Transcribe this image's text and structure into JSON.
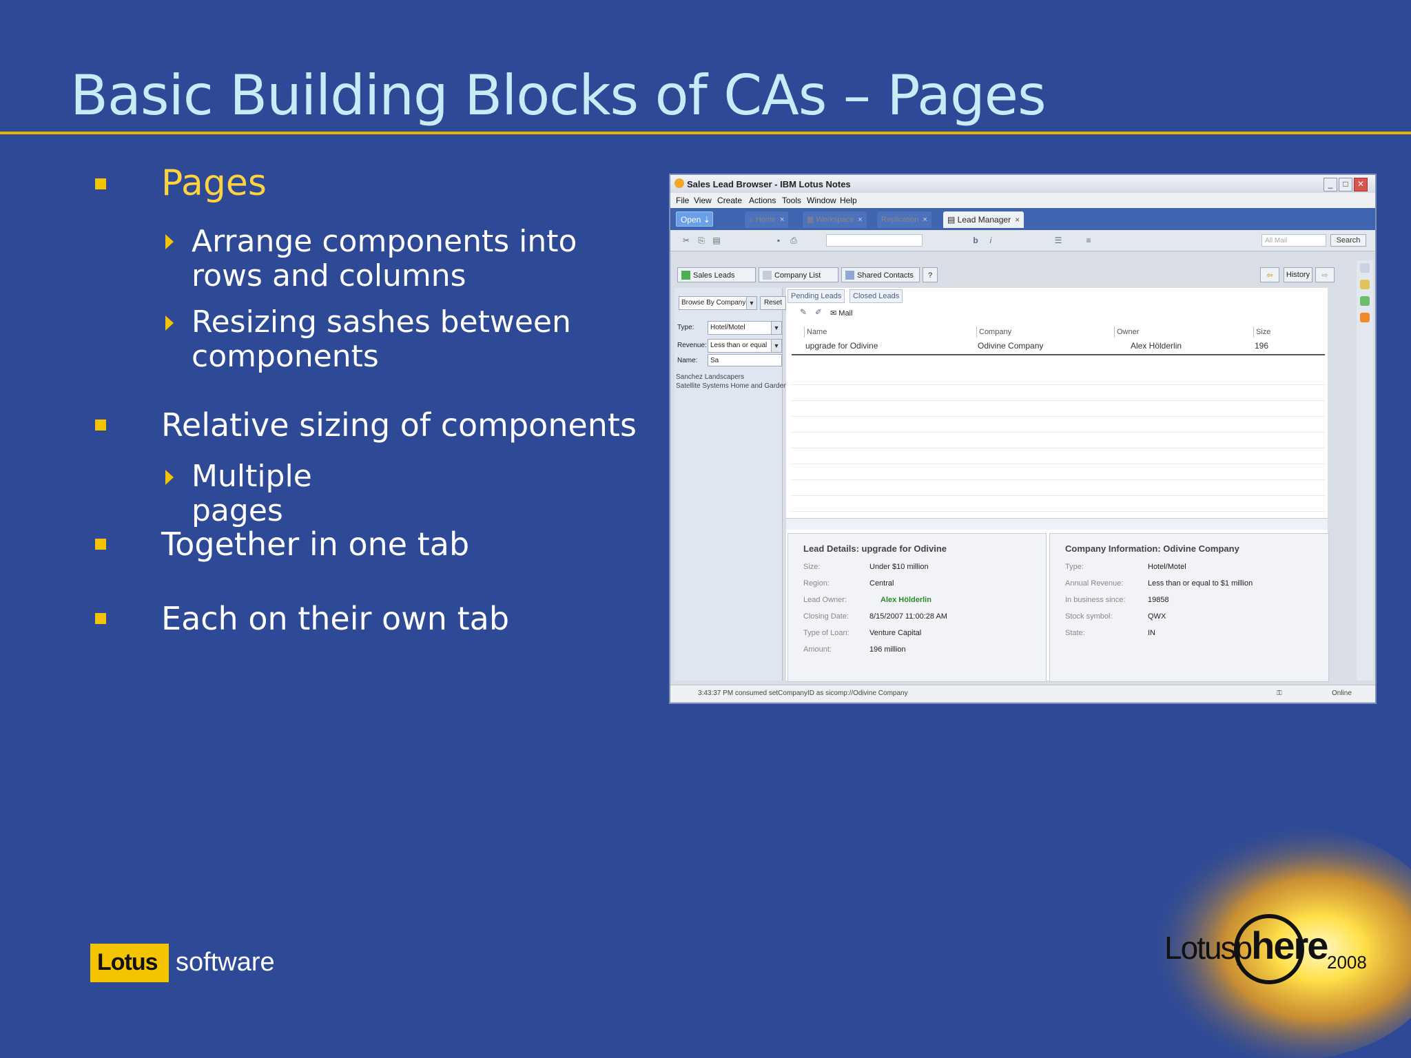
{
  "slide": {
    "title": "Basic Building Blocks of CAs – Pages",
    "bullets": [
      {
        "text": "Pages",
        "subs": [
          "Arrange components into rows and columns",
          "Resizing sashes between components"
        ]
      },
      {
        "text": "Relative sizing of components",
        "subs": [
          "Multiple pages"
        ]
      },
      {
        "text": "Together in one tab",
        "subs": []
      },
      {
        "text": "Each on their own tab",
        "subs": []
      }
    ]
  },
  "window": {
    "title": "Sales Lead Browser - IBM Lotus Notes",
    "menu": [
      "File",
      "View",
      "Create",
      "Actions",
      "Tools",
      "Window",
      "Help"
    ],
    "open_label": "Open",
    "tabs": [
      "Home",
      "Workspace",
      "Replication",
      "Lead Manager"
    ],
    "toolbar": {
      "mail_placeholder": "All Mail",
      "search_label": "Search"
    },
    "subtabs": [
      "Sales Leads",
      "Company List",
      "Shared Contacts"
    ],
    "history_label": "History",
    "left": {
      "browse": "Browse By Company",
      "reset": "Reset",
      "type_label": "Type:",
      "type_value": "Hotel/Motel",
      "revenue_label": "Revenue:",
      "revenue_value": "Less than or equal",
      "name_label": "Name:",
      "name_value": "Sa",
      "results": [
        "Sanchez Landscapers",
        "Satellite Systems Home and Garden"
      ]
    },
    "center": {
      "view_tabs": [
        "Pending Leads",
        "Closed Leads"
      ],
      "mail_label": "Mail",
      "columns": [
        "Name",
        "Company",
        "Owner",
        "Size"
      ],
      "rows": [
        {
          "name": "upgrade for Odivine",
          "company": "Odivine Company",
          "owner": "Alex Hölderlin",
          "size": "196"
        }
      ]
    },
    "lead_details": {
      "title": "Lead Details: upgrade for Odivine",
      "fields": [
        {
          "k": "Size:",
          "v": "Under $10 million"
        },
        {
          "k": "Region:",
          "v": "Central"
        },
        {
          "k": "Lead Owner:",
          "v": "Alex Hölderlin"
        },
        {
          "k": "Closing Date:",
          "v": "8/15/2007 11:00:28 AM"
        },
        {
          "k": "Type of Loan:",
          "v": "Venture Capital"
        },
        {
          "k": "Amount:",
          "v": "196 million"
        }
      ]
    },
    "company_info": {
      "title": "Company Information: Odivine Company",
      "fields": [
        {
          "k": "Type:",
          "v": "Hotel/Motel"
        },
        {
          "k": "Annual Revenue:",
          "v": "Less than or equal to $1 million"
        },
        {
          "k": "In business since:",
          "v": "19858"
        },
        {
          "k": "Stock symbol:",
          "v": "QWX"
        },
        {
          "k": "State:",
          "v": "IN"
        }
      ]
    },
    "status": {
      "message": "3:43:37 PM consumed setCompanyID as sicomp://Odivine Company",
      "online": "Online"
    }
  },
  "branding": {
    "lotus": "Lotus",
    "software": "software",
    "sphere_a": "Lotusp",
    "sphere_b": "here",
    "year": "2008"
  },
  "colors": {
    "background": "#2e4996",
    "title": "#c6ecf7",
    "accent": "#f5c400"
  }
}
